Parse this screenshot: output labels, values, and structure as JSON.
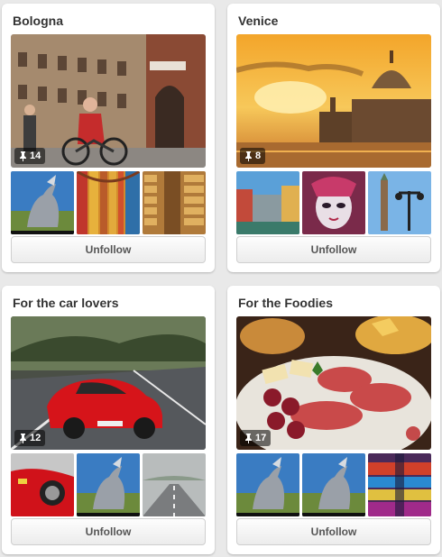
{
  "boards": [
    {
      "title": "Bologna",
      "pin_count": "14",
      "button_label": "Unfollow",
      "cover": "bologna-street-cyclists-photo",
      "thumbs": [
        "unicorn-sculpture-photo",
        "colorful-arcade-photo",
        "cheese-warehouse-photo"
      ]
    },
    {
      "title": "Venice",
      "pin_count": "8",
      "button_label": "Unfollow",
      "cover": "venice-sunset-basilica-photo",
      "thumbs": [
        "venice-canal-photo",
        "carnival-mask-photo",
        "venice-campanile-photo"
      ]
    },
    {
      "title": "For the car lovers",
      "pin_count": "12",
      "button_label": "Unfollow",
      "cover": "red-ferrari-road-photo",
      "thumbs": [
        "red-ferrari-closeup-photo",
        "unicorn-sculpture-photo",
        "misty-road-photo"
      ]
    },
    {
      "title": "For the Foodies",
      "pin_count": "17",
      "button_label": "Unfollow",
      "cover": "antipasto-platter-photo",
      "thumbs": [
        "unicorn-sculpture-photo",
        "unicorn-sculpture-photo",
        "colorful-market-stall-photo"
      ]
    }
  ],
  "icons": {
    "pin": "pin-icon"
  }
}
